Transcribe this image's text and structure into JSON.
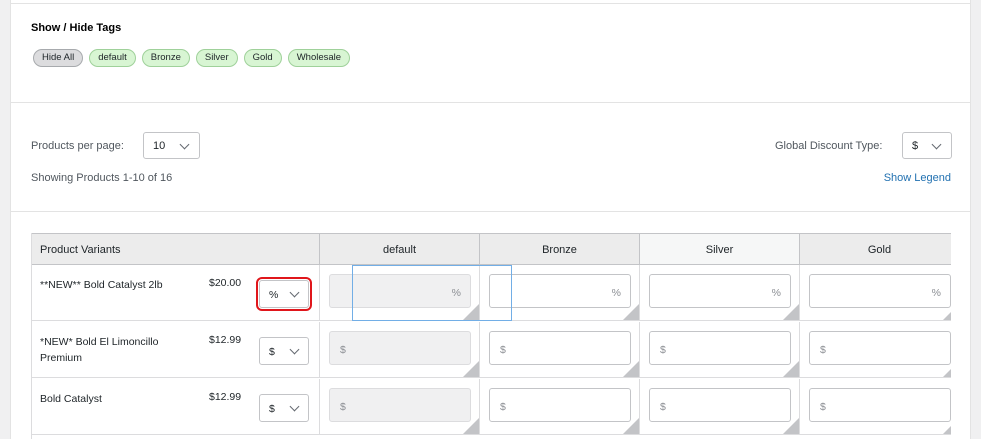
{
  "tags": {
    "title": "Show / Hide Tags",
    "items": [
      {
        "label": "Hide All",
        "style": "gray"
      },
      {
        "label": "default",
        "style": "green"
      },
      {
        "label": "Bronze",
        "style": "green"
      },
      {
        "label": "Silver",
        "style": "green"
      },
      {
        "label": "Gold",
        "style": "green"
      },
      {
        "label": "Wholesale",
        "style": "green"
      }
    ]
  },
  "controls": {
    "per_page_label": "Products per page:",
    "per_page_value": "10",
    "discount_type_label": "Global Discount Type:",
    "discount_type_value": "$",
    "showing_text": "Showing Products 1-10 of 16",
    "legend_link": "Show Legend"
  },
  "table": {
    "headers": [
      "Product Variants",
      "default",
      "Bronze",
      "Silver",
      "Gold"
    ],
    "rows": [
      {
        "name": "**NEW** Bold Catalyst 2lb",
        "price": "$20.00",
        "type": "%",
        "symbol": "%"
      },
      {
        "name": "*NEW* Bold El Limoncillo Premium",
        "price": "$12.99",
        "type": "$",
        "symbol": "$"
      },
      {
        "name": "Bold Catalyst",
        "price": "$12.99",
        "type": "$",
        "symbol": "$"
      }
    ]
  },
  "colors": {
    "accent": "#2271b1",
    "highlight": "#e0161b",
    "tag_green": "#d8f5d3"
  }
}
